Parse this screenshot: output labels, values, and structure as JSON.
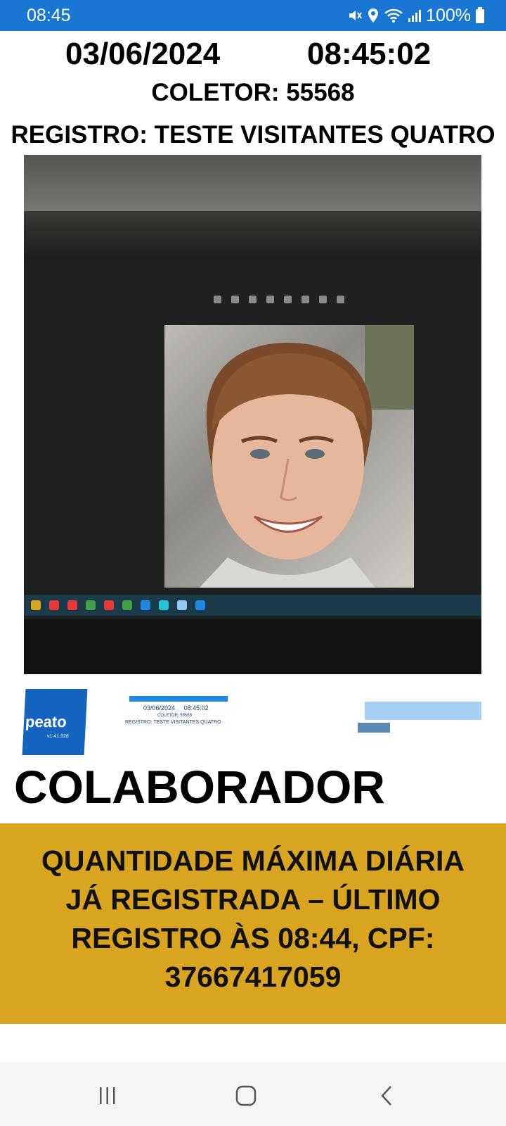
{
  "status_bar": {
    "time": "08:45",
    "battery": "100%",
    "icons": [
      "mute-icon",
      "location-icon",
      "wifi-icon",
      "signal-icon",
      "battery-icon"
    ]
  },
  "header": {
    "date": "03/06/2024",
    "time": "08:45:02",
    "collector": "COLETOR: 55568",
    "record": "REGISTRO: TESTE VISITANTES QUATRO"
  },
  "photo": {
    "logo_text": "peato",
    "logo_subtext": "v1.41.928",
    "mini_date": "03/06/2024",
    "mini_time": "08:45:02",
    "mini_collector": "COLETOR: 55568",
    "mini_record": "REGISTRO: TESTE VISITANTES QUATRO"
  },
  "result": {
    "category": "COLABORADOR",
    "message": "QUANTIDADE MÁXIMA DIÁRIA JÁ REGISTRADA – ÚLTIMO REGISTRO ÀS 08:44, CPF: 37667417059",
    "message_color": "#d9a520"
  },
  "navigation": {
    "buttons": [
      "recents-icon",
      "home-icon",
      "back-icon"
    ]
  },
  "colors": {
    "status_bar": "#1976d2",
    "message_bg": "#d9a520",
    "nav_bar": "#f5f5f5"
  }
}
